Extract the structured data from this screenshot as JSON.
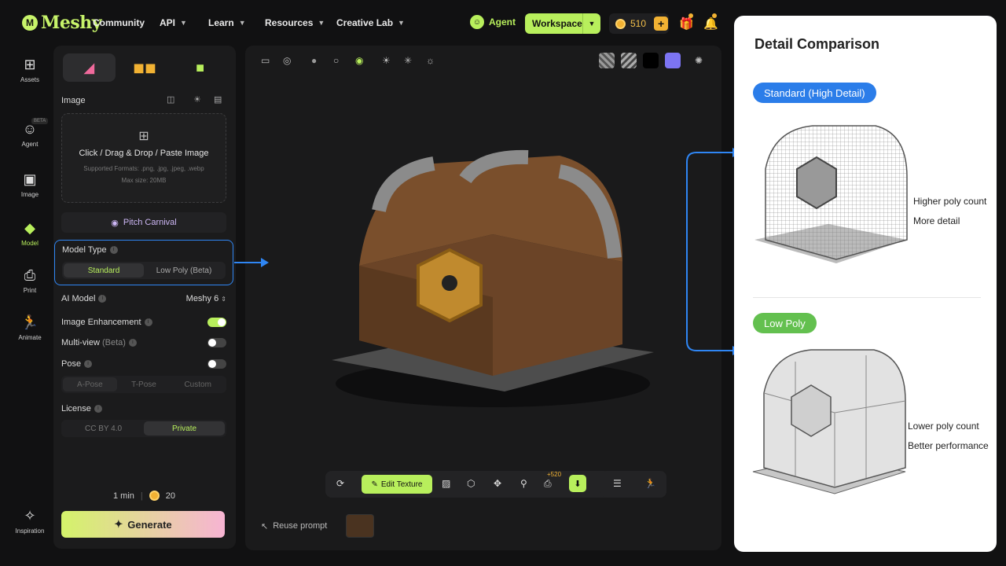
{
  "brand": {
    "logo_text": "Meshy",
    "logo_mark": "M"
  },
  "nav": {
    "links": [
      "Community",
      "API",
      "Learn",
      "Resources",
      "Creative Lab"
    ],
    "agent_label": "Agent",
    "workspace_label": "Workspace",
    "credits": "510",
    "plus": "+"
  },
  "rail": {
    "items": [
      {
        "label": "Assets",
        "icon": "grid-icon"
      },
      {
        "label": "Agent",
        "icon": "agent-icon",
        "badge": "BETA"
      },
      {
        "label": "Image",
        "icon": "image-icon"
      },
      {
        "label": "Model",
        "icon": "cube-icon"
      },
      {
        "label": "Print",
        "icon": "printer-icon"
      },
      {
        "label": "Animate",
        "icon": "running-icon"
      },
      {
        "label": "Inspiration",
        "icon": "sparkle-icon"
      }
    ]
  },
  "panel": {
    "image_label": "Image",
    "upload_text": "Click / Drag & Drop / Paste Image",
    "upload_formats": "Supported Formats: .png, .jpg, .jpeg, .webp",
    "upload_max": "Max size: 20MB",
    "carnival": "Pitch Carnival",
    "model_type_label": "Model Type",
    "model_types": [
      "Standard",
      "Low Poly (Beta)"
    ],
    "ai_model_label": "AI Model",
    "ai_model_value": "Meshy 6",
    "image_enh_label": "Image Enhancement",
    "multiview_label": "Multi-view",
    "multiview_suffix": "(Beta)",
    "pose_label": "Pose",
    "poses": [
      "A-Pose",
      "T-Pose",
      "Custom"
    ],
    "license_label": "License",
    "licenses": [
      "CC BY 4.0",
      "Private"
    ],
    "time": "1 min",
    "cost": "20",
    "generate": "Generate"
  },
  "viewport": {
    "edit_texture": "Edit Texture",
    "badge": "+520",
    "reuse_prompt": "Reuse prompt"
  },
  "compare": {
    "title": "Detail Comparison",
    "standard_pill": "Standard (High Detail)",
    "standard_notes": [
      "Higher poly count",
      "More detail"
    ],
    "lowpoly_pill": "Low Poly",
    "lowpoly_notes": [
      "Lower poly count",
      "Better performance"
    ]
  },
  "colors": {
    "accent_green": "#b8ef5c",
    "highlight_blue": "#2f86f4",
    "lowpoly_green": "#63c04f",
    "pill_blue": "#2b7de9"
  }
}
